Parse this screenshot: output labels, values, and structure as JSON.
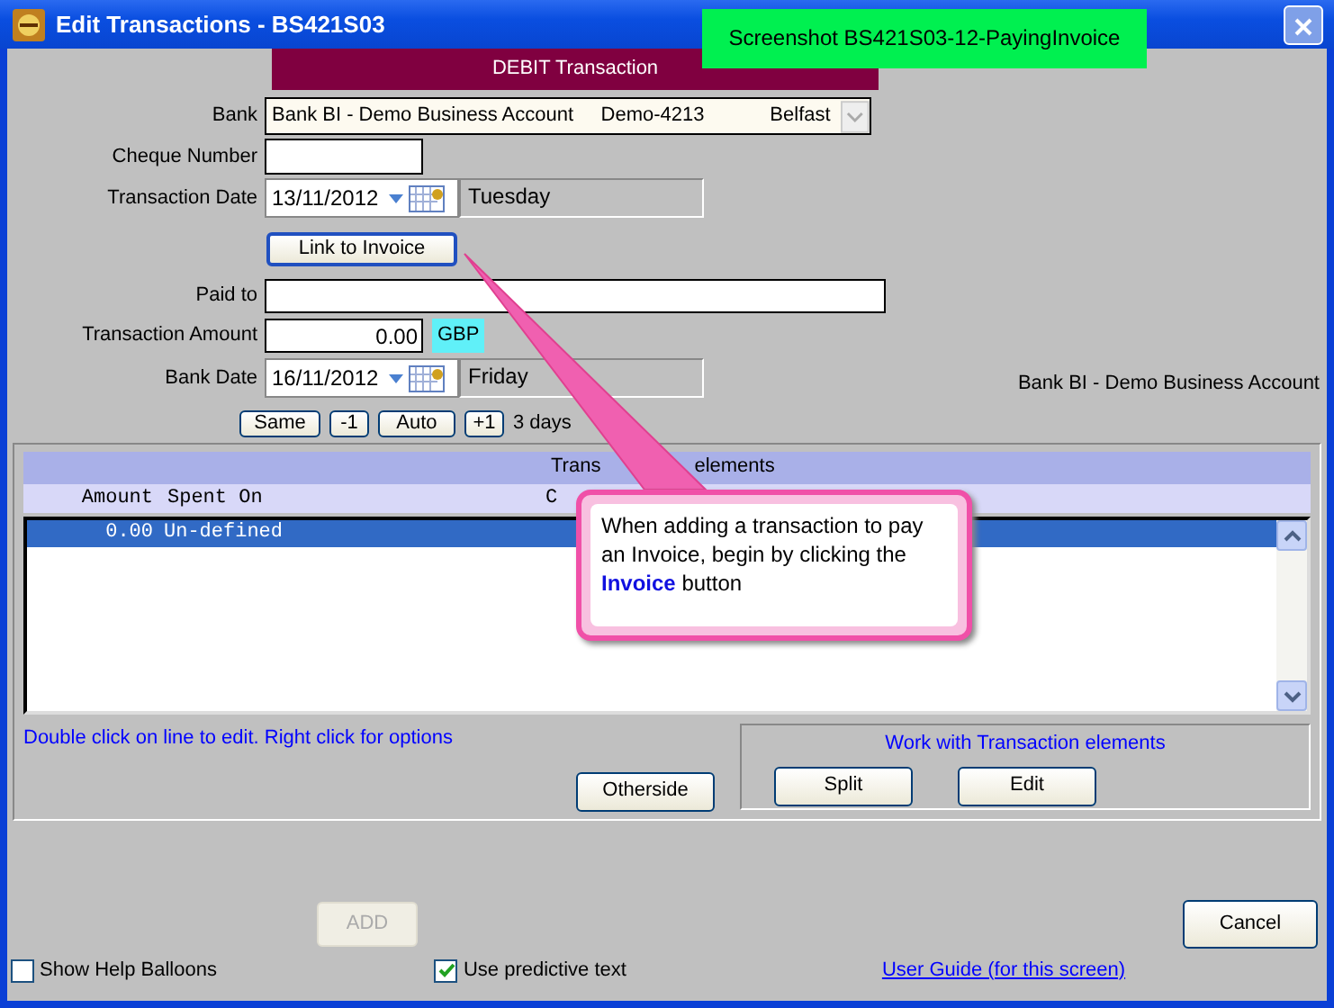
{
  "window": {
    "title": "Edit Transactions - BS421S03"
  },
  "caption": "Screenshot BS421S03-12-PayingInvoice",
  "banner": "DEBIT Transaction",
  "fields": [
    {
      "kind": "select",
      "label": "Bank",
      "parts": [
        "Bank BI - Demo Business Account",
        "Demo-4213",
        "Belfast"
      ]
    },
    {
      "kind": "short-text",
      "label": "Cheque Number"
    },
    {
      "kind": "date",
      "label": "Transaction Date",
      "value": "13/11/2012",
      "day": "Tuesday"
    },
    {
      "kind": "button",
      "text": "Link to Invoice"
    },
    {
      "kind": "long-text",
      "label": "Paid to"
    },
    {
      "kind": "amount",
      "label": "Transaction Amount",
      "value": "0.00",
      "currency": "GBP"
    },
    {
      "kind": "date",
      "label": "Bank Date",
      "value": "16/11/2012",
      "day": "Friday",
      "note": "Bank BI - Demo Business Account"
    }
  ],
  "date_buttons": [
    "Same",
    "-1",
    "Auto",
    "+1"
  ],
  "date_gap": "3 days",
  "elements": {
    "title": [
      "Trans",
      "elements"
    ],
    "columns": [
      "Amount",
      "Spent On",
      "C"
    ],
    "rows": [
      {
        "cells": [
          "0.00",
          "Un-defined"
        ],
        "selected": true
      }
    ],
    "hint": "Double click on line to edit. Right click for options",
    "otherside": "Otherside",
    "group": {
      "title": "Work with Transaction elements",
      "buttons": [
        "Split",
        "Edit"
      ]
    }
  },
  "add": {
    "text": "ADD",
    "disabled": true
  },
  "cancel": "Cancel",
  "checkboxes": [
    {
      "label": "Show Help Balloons",
      "checked": false
    },
    {
      "label": "Use predictive text",
      "checked": true
    }
  ],
  "link": "User Guide (for this screen)",
  "callout": "When adding a transaction to pay an Invoice, begin by clicking the **Invoice** button"
}
